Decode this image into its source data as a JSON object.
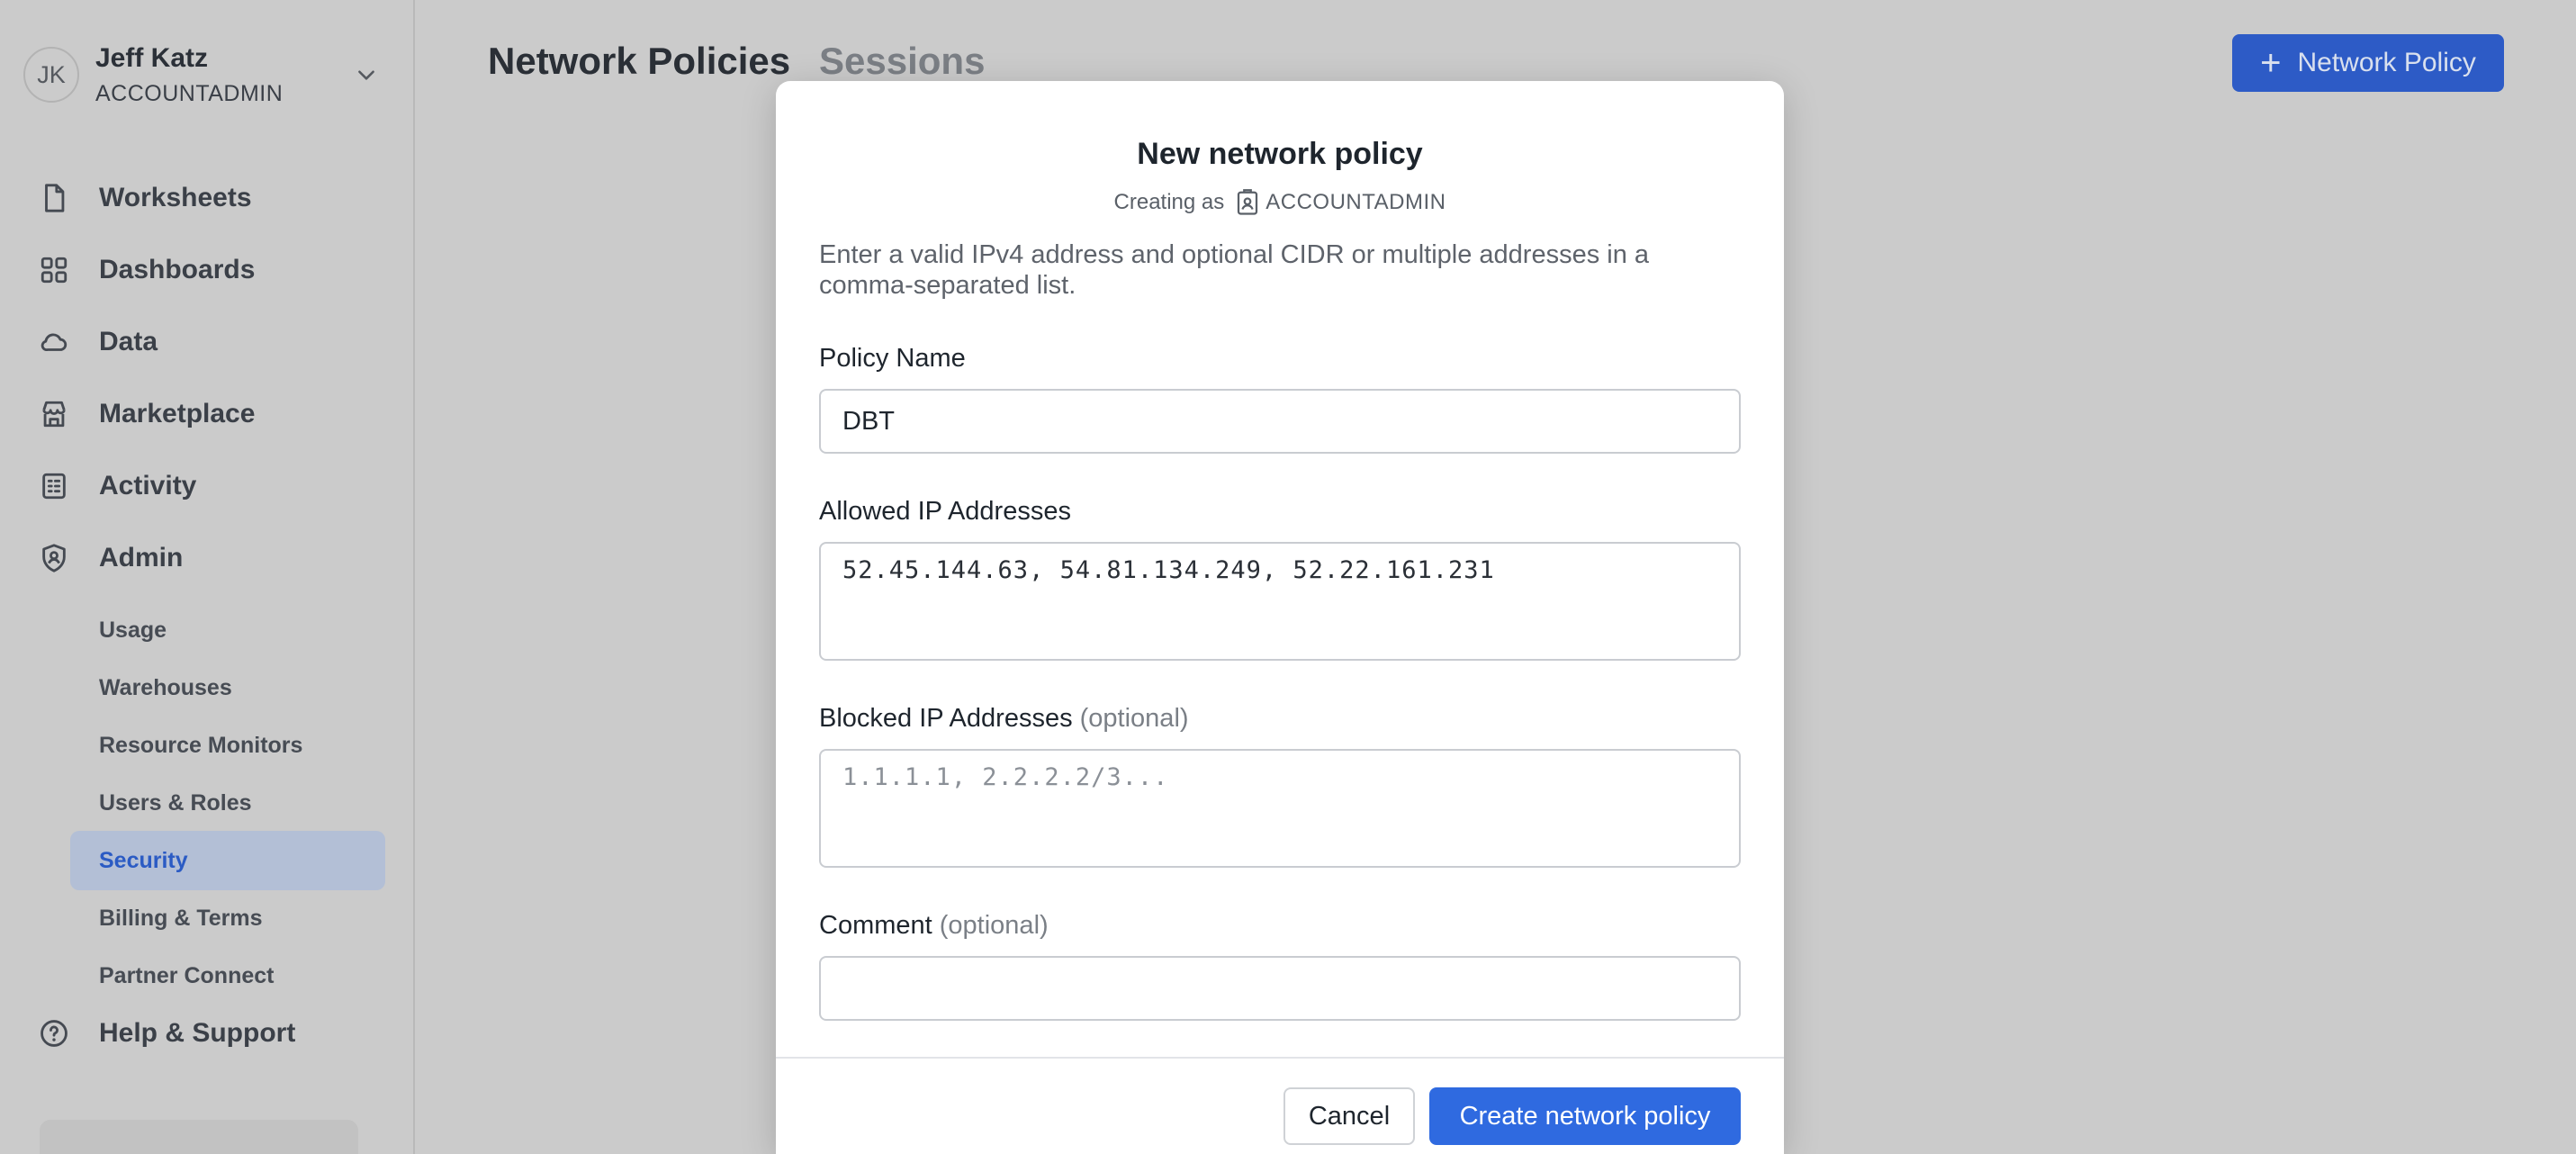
{
  "user": {
    "initials": "JK",
    "name": "Jeff Katz",
    "role": "ACCOUNTADMIN"
  },
  "nav": {
    "items": [
      {
        "label": "Worksheets",
        "icon": "document-icon"
      },
      {
        "label": "Dashboards",
        "icon": "grid-icon"
      },
      {
        "label": "Data",
        "icon": "cloud-icon"
      },
      {
        "label": "Marketplace",
        "icon": "store-icon"
      },
      {
        "label": "Activity",
        "icon": "activity-list-icon"
      },
      {
        "label": "Admin",
        "icon": "shield-icon"
      }
    ],
    "admin_sub": [
      "Usage",
      "Warehouses",
      "Resource Monitors",
      "Users & Roles",
      "Security",
      "Billing & Terms",
      "Partner Connect"
    ],
    "active_sub": "Security",
    "help": {
      "label": "Help & Support",
      "icon": "help-circle-icon"
    }
  },
  "header": {
    "tabs": [
      "Network Policies",
      "Sessions"
    ],
    "active_tab": "Network Policies",
    "primary_button": "Network Policy"
  },
  "modal": {
    "title": "New network policy",
    "creating_as_label": "Creating as",
    "creating_as_role": "ACCOUNTADMIN",
    "description": "Enter a valid IPv4 address and optional CIDR or multiple addresses in a comma-separated list.",
    "policy_name": {
      "label": "Policy Name",
      "value": "DBT"
    },
    "allowed_ips": {
      "label": "Allowed IP Addresses",
      "value": "52.45.144.63, 54.81.134.249, 52.22.161.231"
    },
    "blocked_ips": {
      "label": "Blocked IP Addresses",
      "optional": "(optional)",
      "placeholder": "1.1.1.1, 2.2.2.2/3..."
    },
    "comment": {
      "label": "Comment",
      "optional": "(optional)",
      "value": ""
    },
    "cancel_label": "Cancel",
    "create_label": "Create network policy"
  },
  "colors": {
    "primary": "#2f6ae0",
    "active_nav_bg": "#b3bfd6",
    "active_nav_text": "#2b5bc4"
  }
}
